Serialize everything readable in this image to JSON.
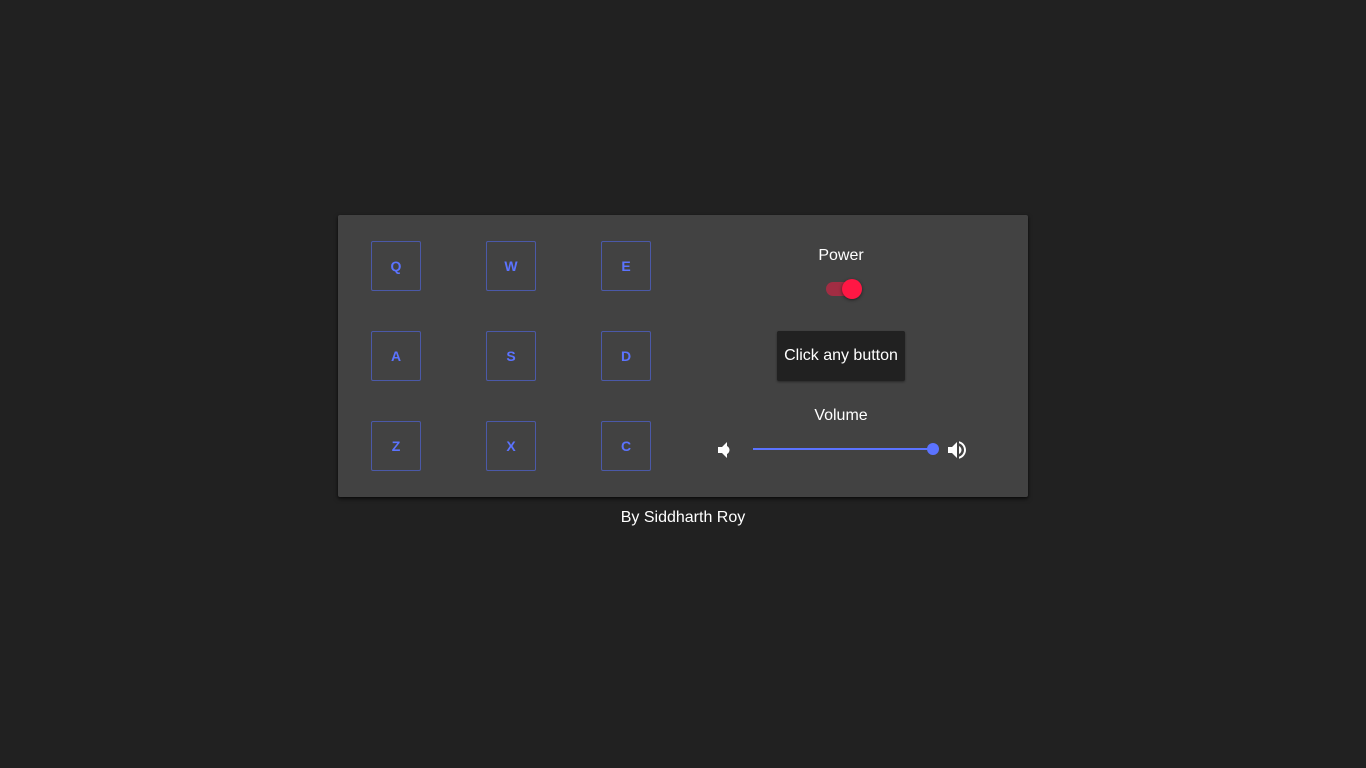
{
  "pads": [
    {
      "key": "Q"
    },
    {
      "key": "W"
    },
    {
      "key": "E"
    },
    {
      "key": "A"
    },
    {
      "key": "S"
    },
    {
      "key": "D"
    },
    {
      "key": "Z"
    },
    {
      "key": "X"
    },
    {
      "key": "C"
    }
  ],
  "power": {
    "label": "Power",
    "on": true
  },
  "display": {
    "text": "Click any button"
  },
  "volume": {
    "label": "Volume",
    "level": 1.0,
    "down_icon": "volume-down-icon",
    "up_icon": "volume-up-icon"
  },
  "footer": {
    "credit": "By Siddharth Roy"
  },
  "colors": {
    "background": "#212121",
    "panel": "#424242",
    "accent": "#5b73ff",
    "power_on": "#ff1744",
    "text": "#ffffff"
  }
}
